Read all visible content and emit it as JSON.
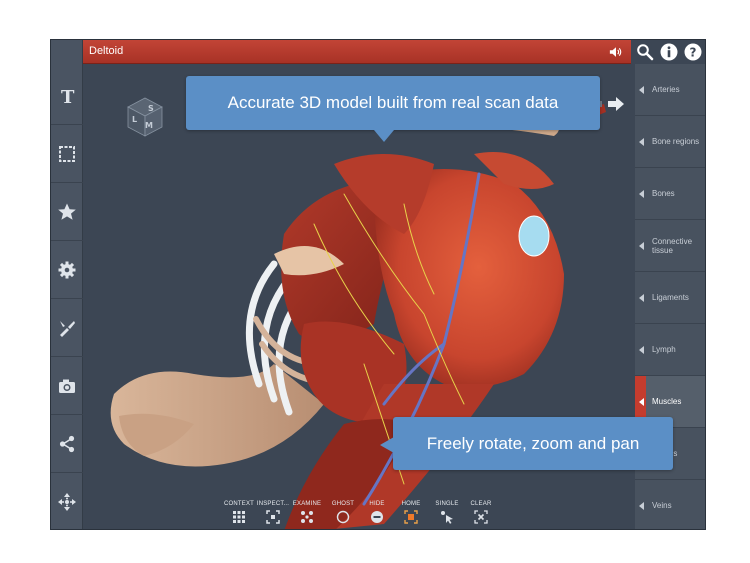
{
  "header": {
    "title": "Deltoid"
  },
  "icons": {
    "sound": "speaker-icon",
    "search": "search-icon",
    "info": "info-icon",
    "help": "help-icon"
  },
  "left_toolbar": [
    {
      "name": "text-tool",
      "icon": "text-icon"
    },
    {
      "name": "select-tool",
      "icon": "selection-icon"
    },
    {
      "name": "favorites-tool",
      "icon": "star-icon"
    },
    {
      "name": "settings-tool",
      "icon": "gear-icon"
    },
    {
      "name": "dissect-tool",
      "icon": "scalpel-icon"
    },
    {
      "name": "camera-tool",
      "icon": "camera-icon"
    },
    {
      "name": "share-tool",
      "icon": "share-icon"
    },
    {
      "name": "move-tool",
      "icon": "move-icon"
    }
  ],
  "nav_cube": {
    "faces": [
      "S",
      "M",
      "L"
    ]
  },
  "categories": [
    {
      "label": "Arteries",
      "active": false
    },
    {
      "label": "Bone regions",
      "active": false
    },
    {
      "label": "Bones",
      "active": false
    },
    {
      "label": "Connective tissue",
      "active": false
    },
    {
      "label": "Ligaments",
      "active": false
    },
    {
      "label": "Lymph",
      "active": false
    },
    {
      "label": "Muscles",
      "active": true
    },
    {
      "label": "Nerves",
      "active": false
    },
    {
      "label": "Veins",
      "active": false
    }
  ],
  "callouts": {
    "top": "Accurate 3D model built from real scan data",
    "bottom": "Freely rotate, zoom and pan"
  },
  "bottom_toolbar": [
    {
      "label": "CONTEXT",
      "icon": "context-icon"
    },
    {
      "label": "INSPECT...",
      "icon": "inspect-icon"
    },
    {
      "label": "EXAMINE",
      "icon": "examine-icon"
    },
    {
      "label": "GHOST",
      "icon": "ghost-icon"
    },
    {
      "label": "HIDE",
      "icon": "hide-icon"
    },
    {
      "label": "HOME",
      "icon": "home-icon"
    },
    {
      "label": "SINGLE",
      "icon": "single-icon"
    },
    {
      "label": "CLEAR",
      "icon": "clear-icon"
    }
  ],
  "colors": {
    "header_red": "#b83a2c",
    "callout_blue": "#5b8fc6",
    "panel_dark": "#48525f",
    "viewport_bg": "#3c4654",
    "muscle_red": "#c0402e"
  }
}
